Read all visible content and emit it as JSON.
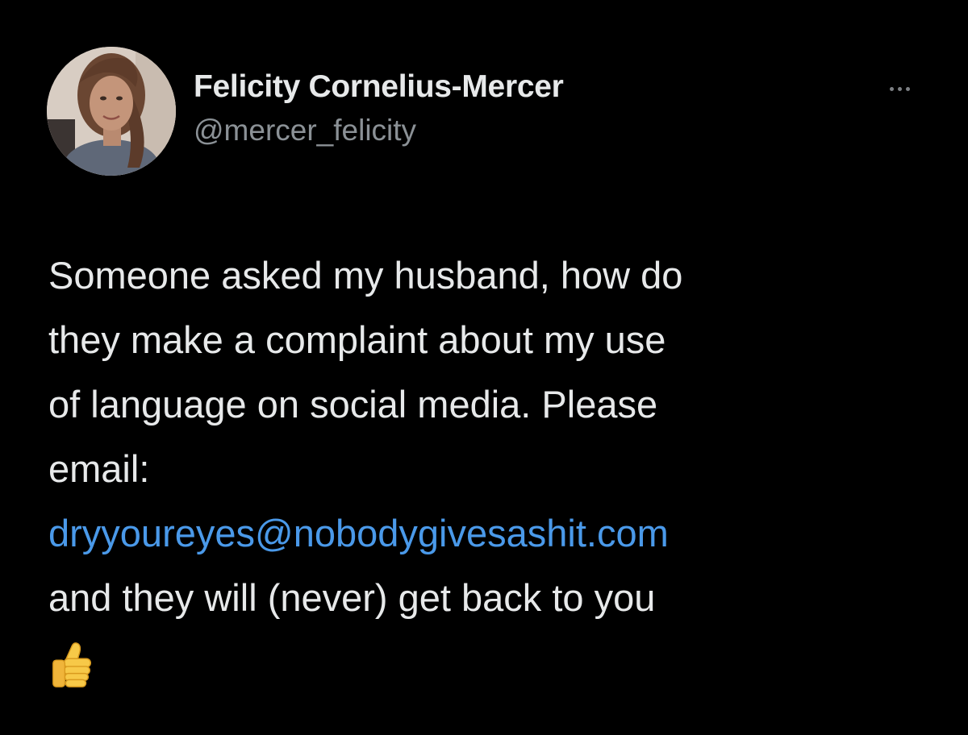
{
  "author": {
    "display_name": "Felicity Cornelius-Mercer",
    "handle": "@mercer_felicity",
    "avatar_icon": "profile-photo"
  },
  "menu": {
    "icon": "more-horizontal-icon"
  },
  "tweet": {
    "lines": [
      "Someone asked my husband, how do",
      "they make a complaint about my use",
      "of language on social media. Please",
      "email:"
    ],
    "email": "dryyoureyes@nobodygivesashit.com",
    "closing": "and they will (never) get back to you",
    "emoji_icon": "thumbs-up-icon"
  },
  "colors": {
    "background": "#000000",
    "text": "#e7e9ea",
    "secondary_text": "#8b9196",
    "link": "#4a99e9"
  }
}
